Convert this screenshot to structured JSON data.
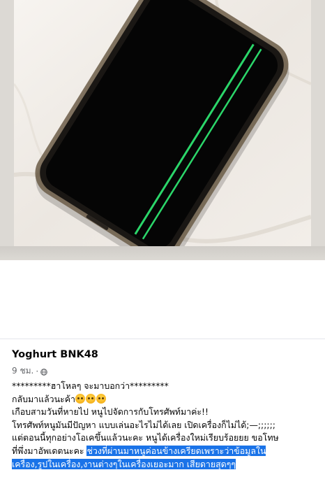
{
  "post": {
    "author": "Yoghurt BNK48",
    "time": "9 ชม.",
    "separator": "·",
    "privacy_icon": "globe-icon",
    "lines": {
      "l1": "*********ฮาโหลๆ จะมาบอกว่า*********",
      "l2": "กลับมาแล้วนะค้า",
      "l2_emoji": "pleading-face-emoji",
      "l3": "เกือบสามวันที่หายไป หนูไปจัดการกับโทรศัพท์มาค่ะ!!",
      "l4": "โทรศัพท์หนูมันมีปัญหา แบบเล่นอะไรไม่ได้เลย เปิดเครื่องก็ไม่ได้;—;;;;;;",
      "l5": "แต่ตอนนี้ทุกอย่างโอเคขึ้นแล้วนะคะ หนูได้เครื่องใหม่เรียบร้อยยย ขอโทษ",
      "l6_plain": "ที่พึ่งมาอัพเดตนะคะ ",
      "l6_highlight": "ช่วงที่ผ่านมาหนูค่อนข้างเครียดเพราะว่าข้อมูลใน",
      "l7_highlight": "เครื่อง,รูปในเครื่อง,งานต่างๆในเครื่องเยอะมาก เสียดายสุดๆๆ"
    }
  },
  "colors": {
    "highlight": "#1a73e8",
    "screen_line": "#2bd66a",
    "phone_body": "#0c0b0b"
  }
}
